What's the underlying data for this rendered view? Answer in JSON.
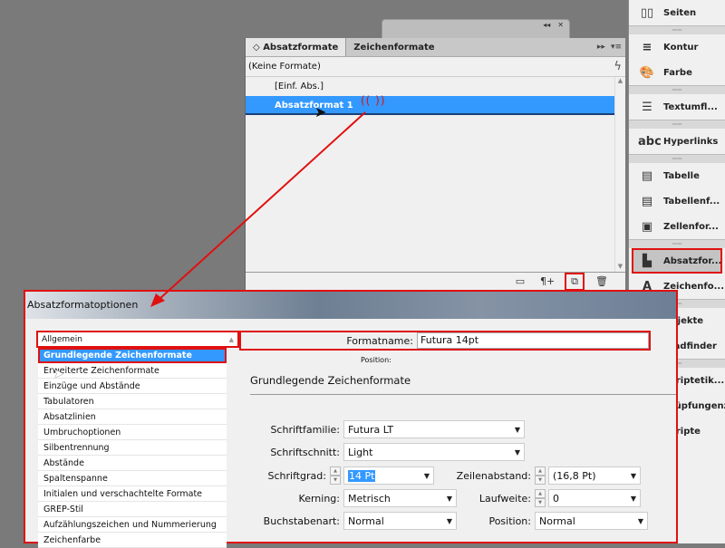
{
  "back_panel": {
    "icons": [
      "collapse-icon",
      "close-icon"
    ],
    "collapse_glyph": "◂◂",
    "close_glyph": "✕"
  },
  "paragraph_panel": {
    "tabs": [
      {
        "label": "Absatzformate",
        "active": true
      },
      {
        "label": "Zeichenformate",
        "active": false
      }
    ],
    "tab_icon_glyph": "◇",
    "expand_glyph": "▸▸",
    "menu_glyph": "▾≡",
    "current_format": "(Keine Formate)",
    "lightning_glyph": "ϟ",
    "items": [
      {
        "label": "[Einf. Abs.]",
        "selected": false
      },
      {
        "label": "Absatzformat 1",
        "selected": true
      }
    ],
    "click_marks": "(( ))",
    "footer_icons": [
      {
        "name": "folder-icon",
        "glyph": "▭"
      },
      {
        "name": "clear-overrides-icon",
        "glyph": "¶+"
      },
      {
        "name": "new-style-icon",
        "glyph": "⧉",
        "highlighted": true
      },
      {
        "name": "trash-icon",
        "glyph": "🗑"
      }
    ]
  },
  "dock": {
    "items": [
      {
        "label": "Seiten",
        "icon": "pages-icon",
        "glyph": "▯▯",
        "sep_before": false
      },
      {
        "label": "Kontur",
        "icon": "stroke-icon",
        "glyph": "≡",
        "sep_before": true
      },
      {
        "label": "Farbe",
        "icon": "color-palette-icon",
        "glyph": "🎨",
        "sep_before": false
      },
      {
        "label": "Textumfl...",
        "icon": "text-wrap-icon",
        "glyph": "☰",
        "sep_before": true
      },
      {
        "label": "Hyperlinks",
        "icon": "hyperlinks-icon",
        "glyph": "abc",
        "sep_before": true
      },
      {
        "label": "Tabelle",
        "icon": "table-icon",
        "glyph": "▤",
        "sep_before": true
      },
      {
        "label": "Tabellenf...",
        "icon": "table-styles-icon",
        "glyph": "▤",
        "sep_before": false
      },
      {
        "label": "Zellenfor...",
        "icon": "cell-styles-icon",
        "glyph": "▣",
        "sep_before": false
      },
      {
        "label": "Absatzfor...",
        "icon": "paragraph-styles-icon",
        "glyph": "▙",
        "sep_before": true,
        "highlighted": true
      },
      {
        "label": "Zeichenfo...",
        "icon": "character-styles-icon",
        "glyph": "A",
        "sep_before": false
      },
      {
        "label": "Objekte",
        "icon": "objects-icon",
        "glyph": "",
        "sep_before": true
      },
      {
        "label": "Pfadfinder",
        "icon": "pathfinder-icon",
        "glyph": "",
        "sep_before": false
      },
      {
        "label": "Skriptetik...",
        "icon": "script-label-icon",
        "glyph": "",
        "sep_before": true
      },
      {
        "label": "Verknüpfungenzusa...",
        "icon": "links-icon",
        "glyph": "",
        "sep_before": false
      },
      {
        "label": "Skripte",
        "icon": "scripts-icon",
        "glyph": "",
        "sep_before": false
      }
    ]
  },
  "dialog": {
    "title": "Absatzformatoptionen",
    "sidebar": {
      "header": "Allgemein",
      "items": [
        {
          "label": "Grundlegende Zeichenformate",
          "selected": true
        },
        {
          "label": "Erweiterte Zeichenformate"
        },
        {
          "label": "Einzüge und Abstände"
        },
        {
          "label": "Tabulatoren"
        },
        {
          "label": "Absatzlinien"
        },
        {
          "label": "Umbruchoptionen"
        },
        {
          "label": "Silbentrennung"
        },
        {
          "label": "Abstände"
        },
        {
          "label": "Spaltenspanne"
        },
        {
          "label": "Initialen und verschachtelte Formate"
        },
        {
          "label": "GREP-Stil"
        },
        {
          "label": "Aufzählungszeichen und Nummerierung"
        },
        {
          "label": "Zeichenfarbe"
        }
      ]
    },
    "format_name_label": "Formatname:",
    "format_name_value": "Futura 14pt",
    "position_label": "Position:",
    "section_title": "Grundlegende Zeichenformate",
    "fields": {
      "font_family": {
        "label": "Schriftfamilie:",
        "value": "Futura LT"
      },
      "font_style": {
        "label": "Schriftschnitt:",
        "value": "Light"
      },
      "font_size": {
        "label": "Schriftgrad:",
        "value": "14 Pt"
      },
      "leading": {
        "label": "Zeilenabstand:",
        "value": "(16,8 Pt)"
      },
      "kerning": {
        "label": "Kerning:",
        "value": "Metrisch"
      },
      "tracking": {
        "label": "Laufweite:",
        "value": "0"
      },
      "case": {
        "label": "Buchstabenart:",
        "value": "Normal"
      },
      "position": {
        "label": "Position:",
        "value": "Normal"
      }
    }
  },
  "annotation_color": "#e01010",
  "selection_color": "#3399ff"
}
